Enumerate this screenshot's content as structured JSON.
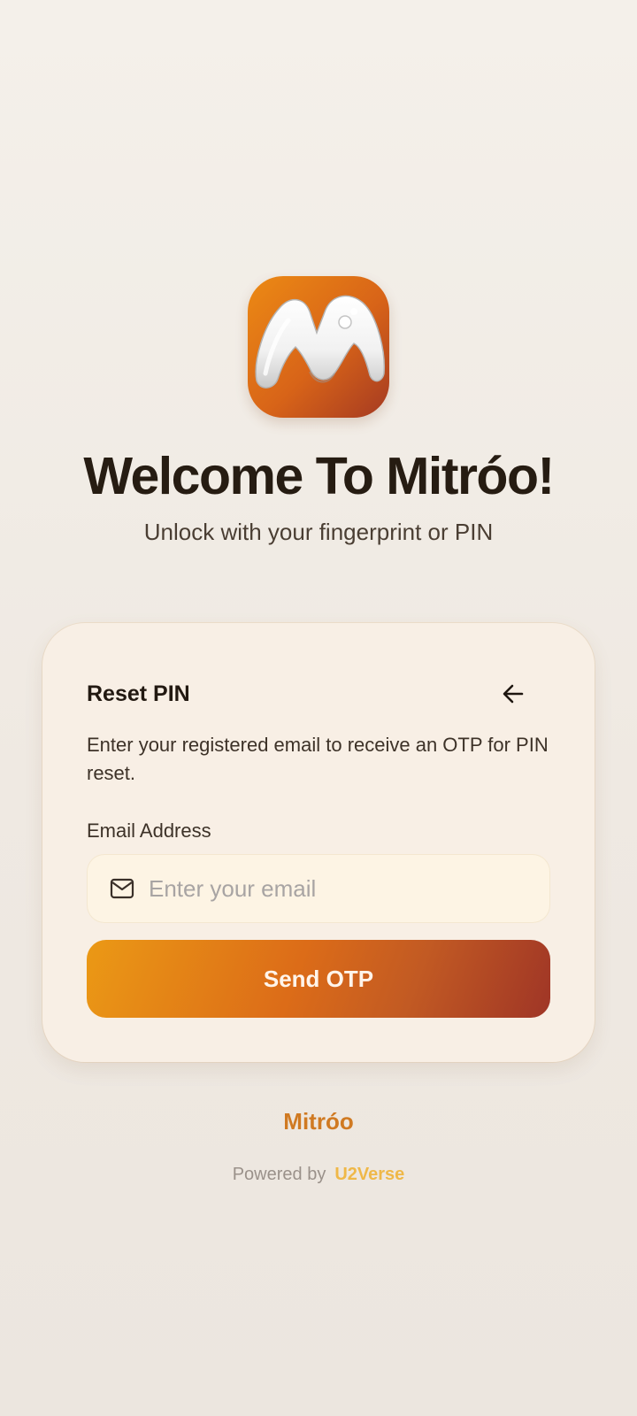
{
  "header": {
    "logo_icon": "mitroo-logo-icon",
    "title": "Welcome To Mitróo!",
    "subtitle": "Unlock with your fingerprint or PIN"
  },
  "reset_card": {
    "title": "Reset PIN",
    "back_icon": "arrow-left-icon",
    "description": "Enter your registered email to receive an OTP for PIN reset.",
    "email_label": "Email Address",
    "email_icon": "mail-icon",
    "email_placeholder": "Enter your email",
    "email_value": "",
    "send_label": "Send OTP"
  },
  "footer": {
    "brand": "Mitróo",
    "powered_by": "Powered by",
    "powered_by_link": "U2Verse"
  },
  "colors": {
    "accent_orange": "#d86418",
    "accent_dark": "#9f3526",
    "brand_text": "#d07a22",
    "powered_link": "#efb848",
    "background": "#f2ede7",
    "card": "#f8efe5"
  }
}
